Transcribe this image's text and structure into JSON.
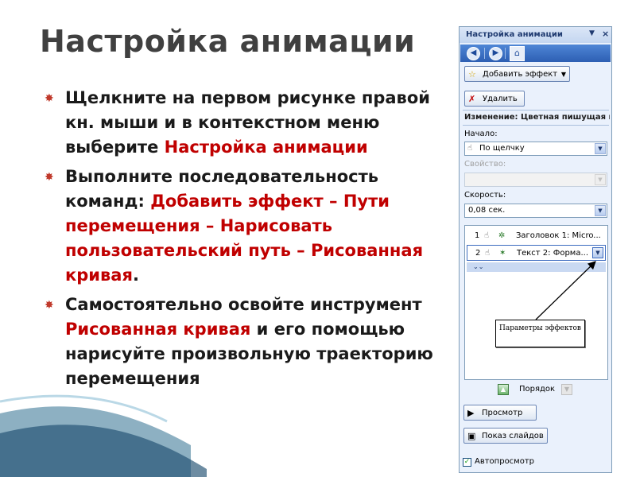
{
  "slide": {
    "title": "Настройка анимации",
    "bullets": [
      {
        "parts": [
          {
            "text": "Щелкните на первом рисунке правой кн. мыши и в контекстном меню выберите ",
            "red": false
          },
          {
            "text": "Настройка анимации",
            "red": true
          }
        ]
      },
      {
        "parts": [
          {
            "text": "Выполните последовательность команд: ",
            "red": false
          },
          {
            "text": "Добавить эффект – Пути перемещения – Нарисовать пользовательский путь – Рисованная кривая",
            "red": true
          },
          {
            "text": ".",
            "red": false
          }
        ]
      },
      {
        "parts": [
          {
            "text": "Самостоятельно освойте инструмент ",
            "red": false
          },
          {
            "text": "Рисованная кривая",
            "red": true
          },
          {
            "text": " и его помощью нарисуйте произвольную траекторию перемещения",
            "red": false
          }
        ]
      }
    ]
  },
  "pane": {
    "title": "Настройка анимации",
    "add_effect_label": "Добавить эффект",
    "delete_label": "Удалить",
    "change_label": "Изменение: Цветная пишущая м",
    "start_label": "Начало:",
    "start_value": "По щелчку",
    "property_label": "Свойство:",
    "property_value": "",
    "speed_label": "Скорость:",
    "speed_value": "0,08 сек.",
    "effects": [
      {
        "num": "1",
        "text": "Заголовок 1: Micro...",
        "selected": false
      },
      {
        "num": "2",
        "text": "Текст 2: Форма...",
        "selected": true
      }
    ],
    "callout_text": "Параметры эффектов",
    "order_label": "Порядок",
    "preview_label": "Просмотр",
    "slideshow_label": "Показ слайдов",
    "autopreview_label": "Автопросмотр",
    "autopreview_checked": true
  },
  "colors": {
    "accent_red": "#c00000",
    "title_gray": "#404040",
    "pane_bg": "#eaf1fc",
    "nav_blue": "#2d5fb3"
  },
  "icons": [
    "home-icon",
    "back-icon",
    "forward-icon",
    "star-icon",
    "delete-icon",
    "play-icon",
    "slideshow-icon",
    "mouse-icon",
    "check-icon"
  ]
}
